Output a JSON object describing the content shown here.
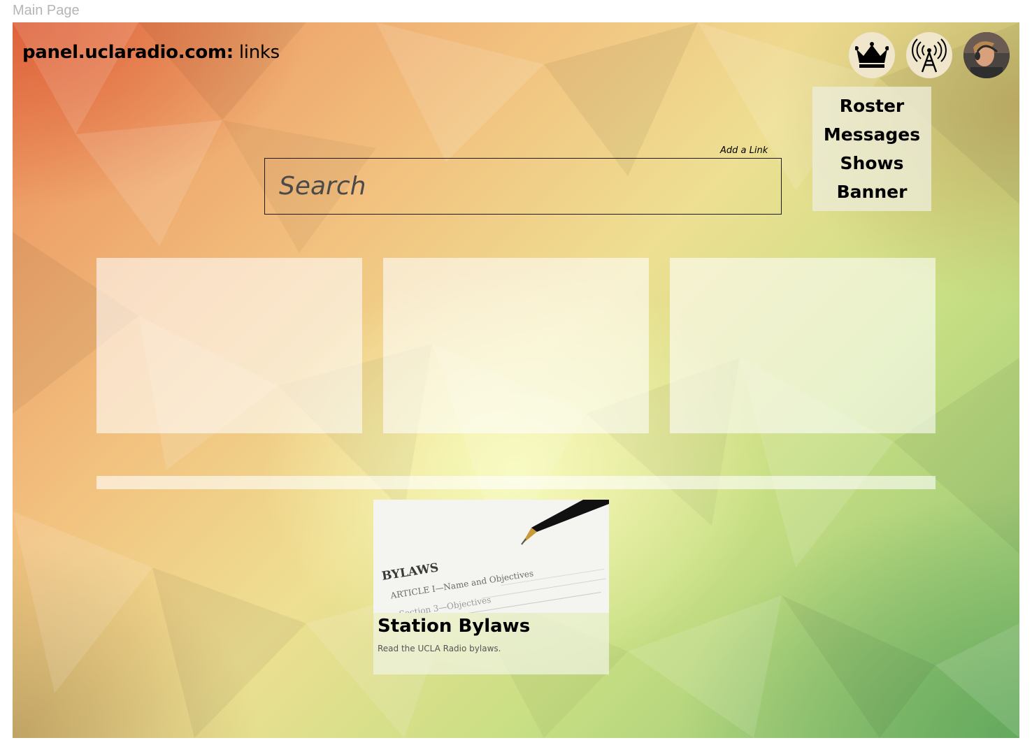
{
  "page_label": "Main Page",
  "header": {
    "site_name": "panel.uclaradio.com:",
    "section": "links"
  },
  "icons": {
    "admin": "crown-icon",
    "broadcast": "radio-tower-icon",
    "profile": "user-avatar"
  },
  "menu": {
    "items": [
      "Roster",
      "Messages",
      "Shows",
      "Banner"
    ]
  },
  "add_link_label": "Add a Link",
  "search": {
    "placeholder": "Search"
  },
  "card": {
    "title": "Station Bylaws",
    "description": "Read the UCLA Radio bylaws.",
    "image": {
      "heading": "BYLAWS",
      "line1": "ARTICLE I—Name and Objectives",
      "line2": "Section 3—Objectives"
    }
  },
  "colors": {
    "top_left": "#e2663e",
    "center": "#f6f8b8",
    "bottom_right": "#62a65c",
    "panel": "#ececd6"
  }
}
